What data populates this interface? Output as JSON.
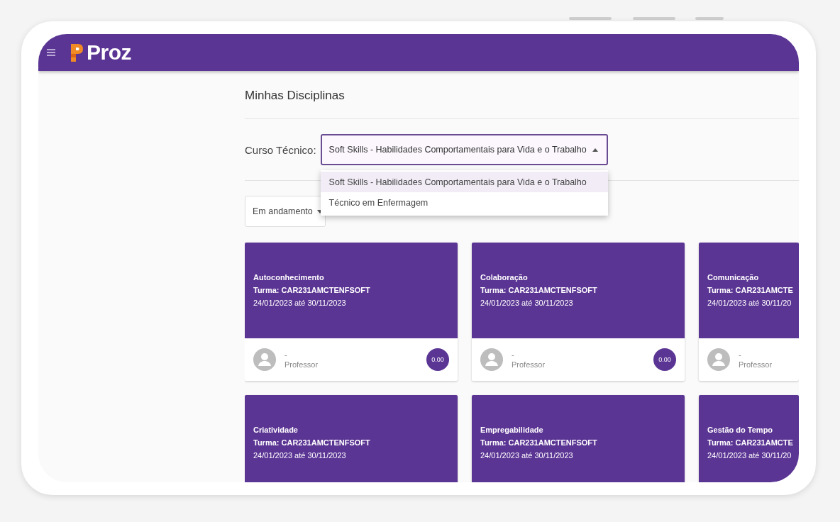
{
  "header": {
    "logo_text": "Proz"
  },
  "page_title": "Minhas Disciplinas",
  "course_select": {
    "label": "Curso Técnico:",
    "value": "Soft Skills - Habilidades Comportamentais para Vida e o Trabalho",
    "expanded": true,
    "options": [
      {
        "label": "Soft Skills - Habilidades Comportamentais para Vida e o Trabalho",
        "selected": true
      },
      {
        "label": "Técnico em Enfermagem",
        "selected": false
      }
    ]
  },
  "status_filter": {
    "value": "Em andamento"
  },
  "cards": [
    {
      "title": "Autoconhecimento",
      "turma": "Turma: CAR231AMCTENFSOFT",
      "dates": "24/01/2023 até 30/11/2023",
      "professor": "-",
      "role": "Professor",
      "grade": "0.00"
    },
    {
      "title": "Colaboração",
      "turma": "Turma: CAR231AMCTENFSOFT",
      "dates": "24/01/2023 até 30/11/2023",
      "professor": "-",
      "role": "Professor",
      "grade": "0.00"
    },
    {
      "title": "Comunicação",
      "turma": "Turma: CAR231AMCTE",
      "dates": "24/01/2023 até 30/11/20",
      "professor": "-",
      "role": "Professor"
    },
    {
      "title": "Criatividade",
      "turma": "Turma: CAR231AMCTENFSOFT",
      "dates": "24/01/2023 até 30/11/2023"
    },
    {
      "title": "Empregabilidade",
      "turma": "Turma: CAR231AMCTENFSOFT",
      "dates": "24/01/2023 até 30/11/2023"
    },
    {
      "title": "Gestão do Tempo",
      "turma": "Turma: CAR231AMCTE",
      "dates": "24/01/2023 até 30/11/20"
    }
  ]
}
